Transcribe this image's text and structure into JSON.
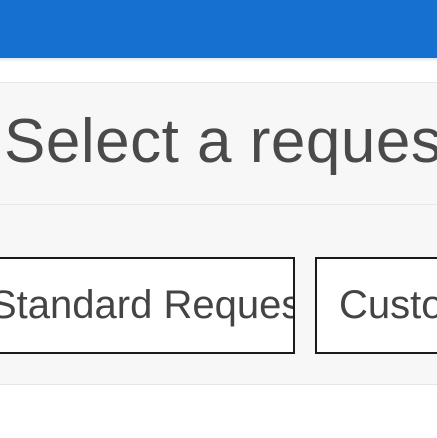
{
  "header": {
    "color": "#1570cf"
  },
  "main": {
    "title": "Select a request",
    "options": [
      {
        "label": "Standard Request"
      },
      {
        "label": "Custom Request"
      }
    ]
  }
}
